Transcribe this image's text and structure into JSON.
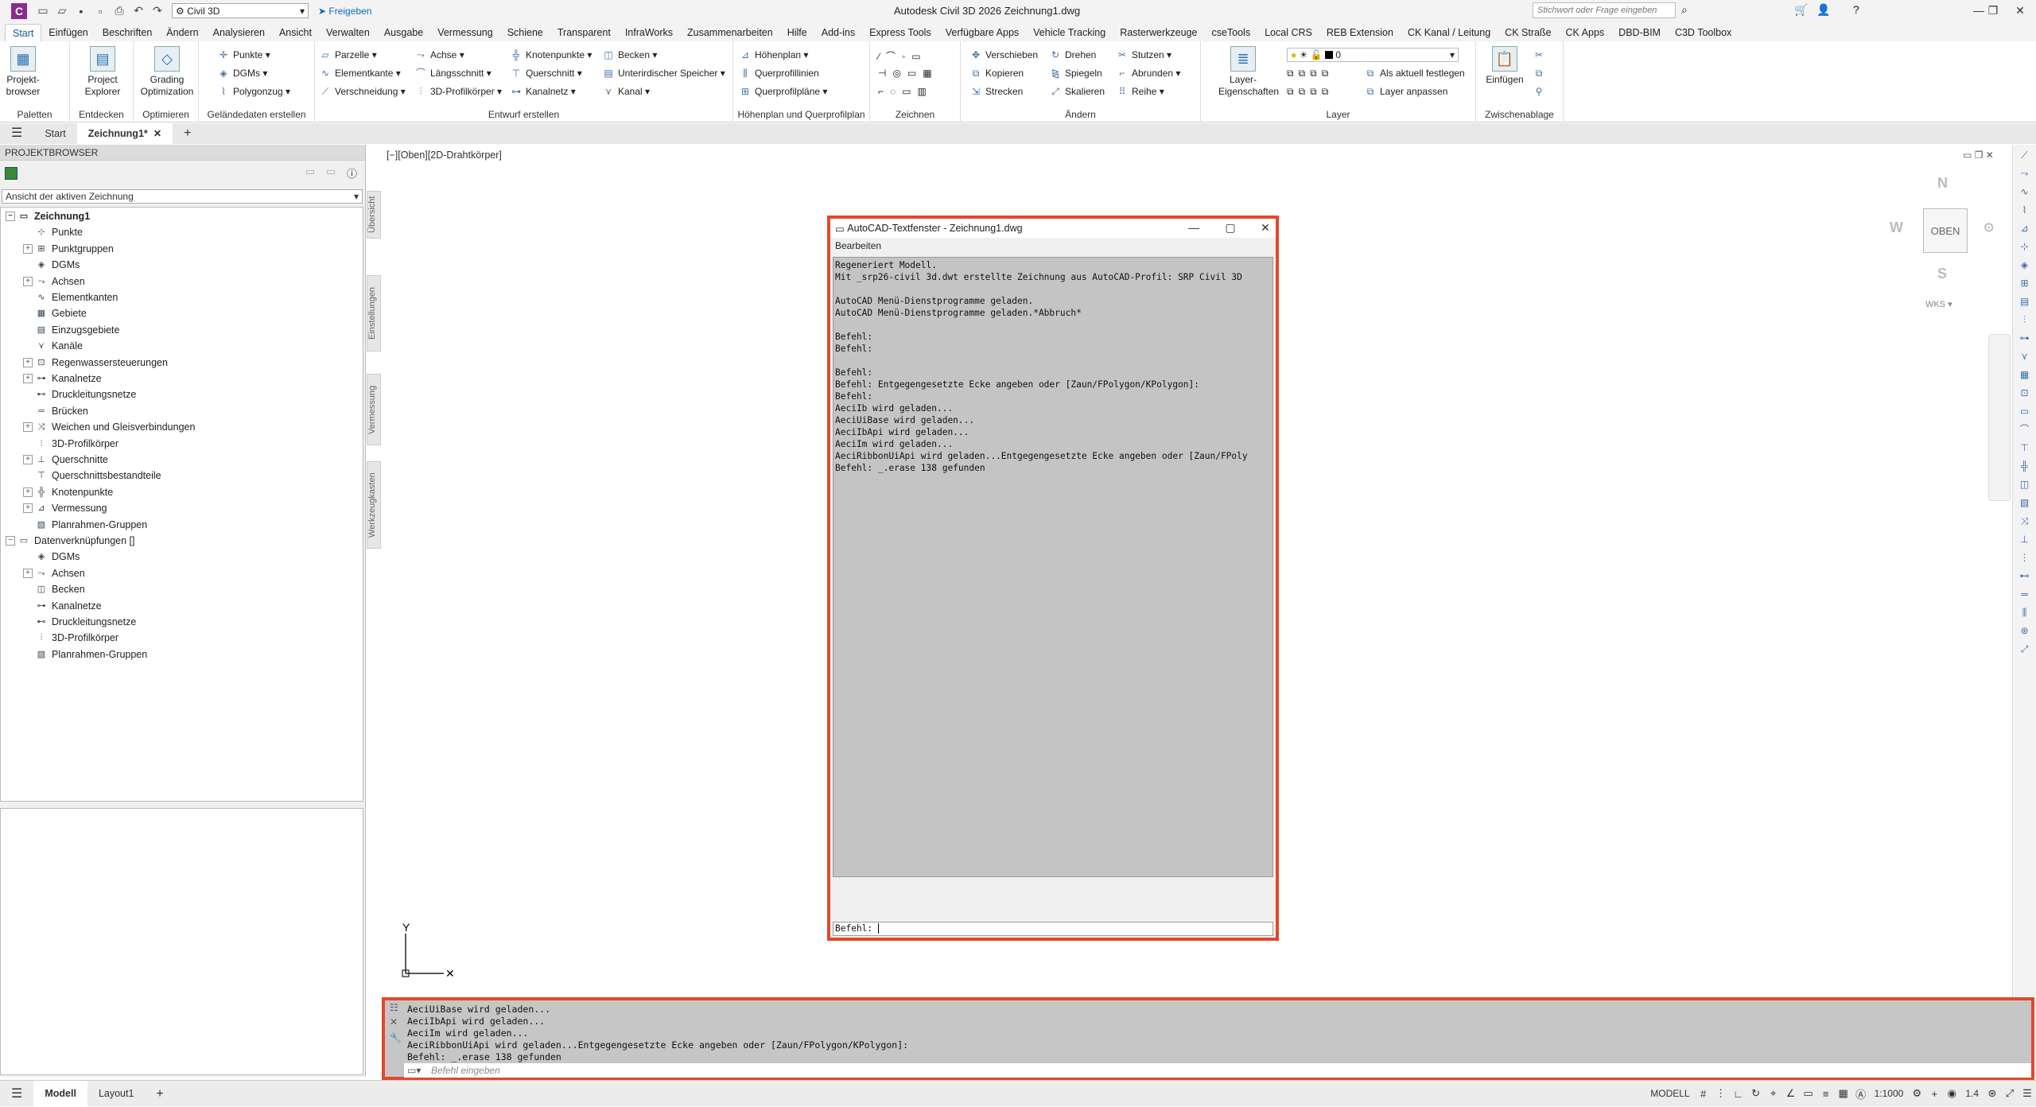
{
  "app": {
    "title": "Autodesk Civil 3D 2026  Zeichnung1.dwg",
    "workspace": "Civil 3D",
    "share": "Freigeben",
    "search_placeholder": "Stichwort oder Frage eingeben"
  },
  "menu": [
    "Start",
    "Einfügen",
    "Beschriften",
    "Ändern",
    "Analysieren",
    "Ansicht",
    "Verwalten",
    "Ausgabe",
    "Vermessung",
    "Schiene",
    "Transparent",
    "InfraWorks",
    "Zusammenarbeiten",
    "Hilfe",
    "Add-ins",
    "Express Tools",
    "Verfügbare Apps",
    "Vehicle Tracking",
    "Rasterwerkzeuge",
    "cseTools",
    "Local CRS",
    "REB Extension",
    "CK Kanal / Leitung",
    "CK Straße",
    "CK Apps",
    "DBD-BIM",
    "C3D Toolbox"
  ],
  "ribbon": {
    "panels": [
      "Paletten",
      "Entdecken",
      "Optimieren",
      "Geländedaten erstellen",
      "Entwurf erstellen",
      "Höhenplan und Querprofilplan",
      "Zeichnen",
      "Ändern",
      "Layer",
      "Zwischenablage"
    ],
    "big": [
      "Projekt-browser",
      "Project Explorer",
      "Grading Optimization",
      "Layer-Eigenschaften",
      "Einfügen"
    ],
    "gelaende": [
      "Punkte",
      "DGMs",
      "Polygonzug"
    ],
    "entwurf1": [
      "Parzelle",
      "Elementkante",
      "Verschneidung"
    ],
    "entwurf2": [
      "Achse",
      "Längsschnitt",
      "3D-Profilkörper"
    ],
    "entwurf3": [
      "Knotenpunkte",
      "Querschnitt",
      "Kanalnetz"
    ],
    "entwurf4": [
      "Becken",
      "Unterirdischer Speicher",
      "Kanal"
    ],
    "hoehen": [
      "Höhenplan",
      "Querprofillinien",
      "Querprofilpläne"
    ],
    "aendern1": [
      "Verschieben",
      "Kopieren",
      "Strecken"
    ],
    "aendern2": [
      "Drehen",
      "Spiegeln",
      "Skalieren"
    ],
    "aendern3": [
      "Stutzen",
      "Abrunden",
      "Reihe"
    ],
    "layer": [
      "Als aktuell festlegen",
      "Layer anpassen"
    ],
    "layer_value": "0"
  },
  "doctabs": [
    "Start",
    "Zeichnung1*"
  ],
  "prospector": {
    "title": "PROJEKTBROWSER",
    "view": "Ansicht der aktiven Zeichnung",
    "tree": [
      "Zeichnung1",
      "Punkte",
      "Punktgruppen",
      "DGMs",
      "Achsen",
      "Elementkanten",
      "Gebiete",
      "Einzugsgebiete",
      "Kanäle",
      "Regenwassersteuerungen",
      "Kanalnetze",
      "Druckleitungsnetze",
      "Brücken",
      "Weichen und Gleisverbindungen",
      "3D-Profilkörper",
      "Querschnitte",
      "Querschnittsbestandteile",
      "Knotenpunkte",
      "Vermessung",
      "Planrahmen-Gruppen",
      "Datenverknüpfungen []",
      "DGMs",
      "Achsen",
      "Becken",
      "Kanalnetze",
      "Druckleitungsnetze",
      "3D-Profilkörper",
      "Planrahmen-Gruppen"
    ],
    "vtabs": [
      "Übersicht",
      "Einstellungen",
      "Vermessung",
      "Werkzeugkasten"
    ]
  },
  "viewport": {
    "label": "[−][Oben][2D-Drahtkörper]",
    "cube": "OBEN",
    "north": "N",
    "south": "S",
    "west": "W",
    "wcs": "WKS ▾"
  },
  "textwindow": {
    "title": "AutoCAD-Textfenster - Zeichnung1.dwg",
    "menu": "Bearbeiten",
    "body": "Regeneriert Modell.\nMit _srp26-civil 3d.dwt erstellte Zeichnung aus AutoCAD-Profil: SRP Civil 3D\n\nAutoCAD Menü-Dienstprogramme geladen.\nAutoCAD Menü-Dienstprogramme geladen.*Abbruch*\n\nBefehl:\nBefehl:\n\nBefehl:\nBefehl: Entgegengesetzte Ecke angeben oder [Zaun/FPolygon/KPolygon]:\nBefehl:\nAeciIb wird geladen...\nAeciUiBase wird geladen...\nAeciIbApi wird geladen...\nAeciIm wird geladen...\nAeciRibbonUiApi wird geladen...Entgegengesetzte Ecke angeben oder [Zaun/FPoly\nBefehl: _.erase 138 gefunden",
    "prompt": "Befehl:"
  },
  "cmdline": {
    "lines": "AeciUiBase wird geladen...\nAeciIbApi wird geladen...\nAeciIm wird geladen...\nAeciRibbonUiApi wird geladen...Entgegengesetzte Ecke angeben oder [Zaun/FPolygon/KPolygon]:\nBefehl: _.erase 138 gefunden",
    "placeholder": "Befehl eingeben"
  },
  "status": {
    "tabs": [
      "Modell",
      "Layout1"
    ],
    "model": "MODELL",
    "scale": "1:1000",
    "weight": "1.4"
  },
  "colors": {
    "highlight": "#e5472c",
    "accent": "#0b5aa8"
  }
}
